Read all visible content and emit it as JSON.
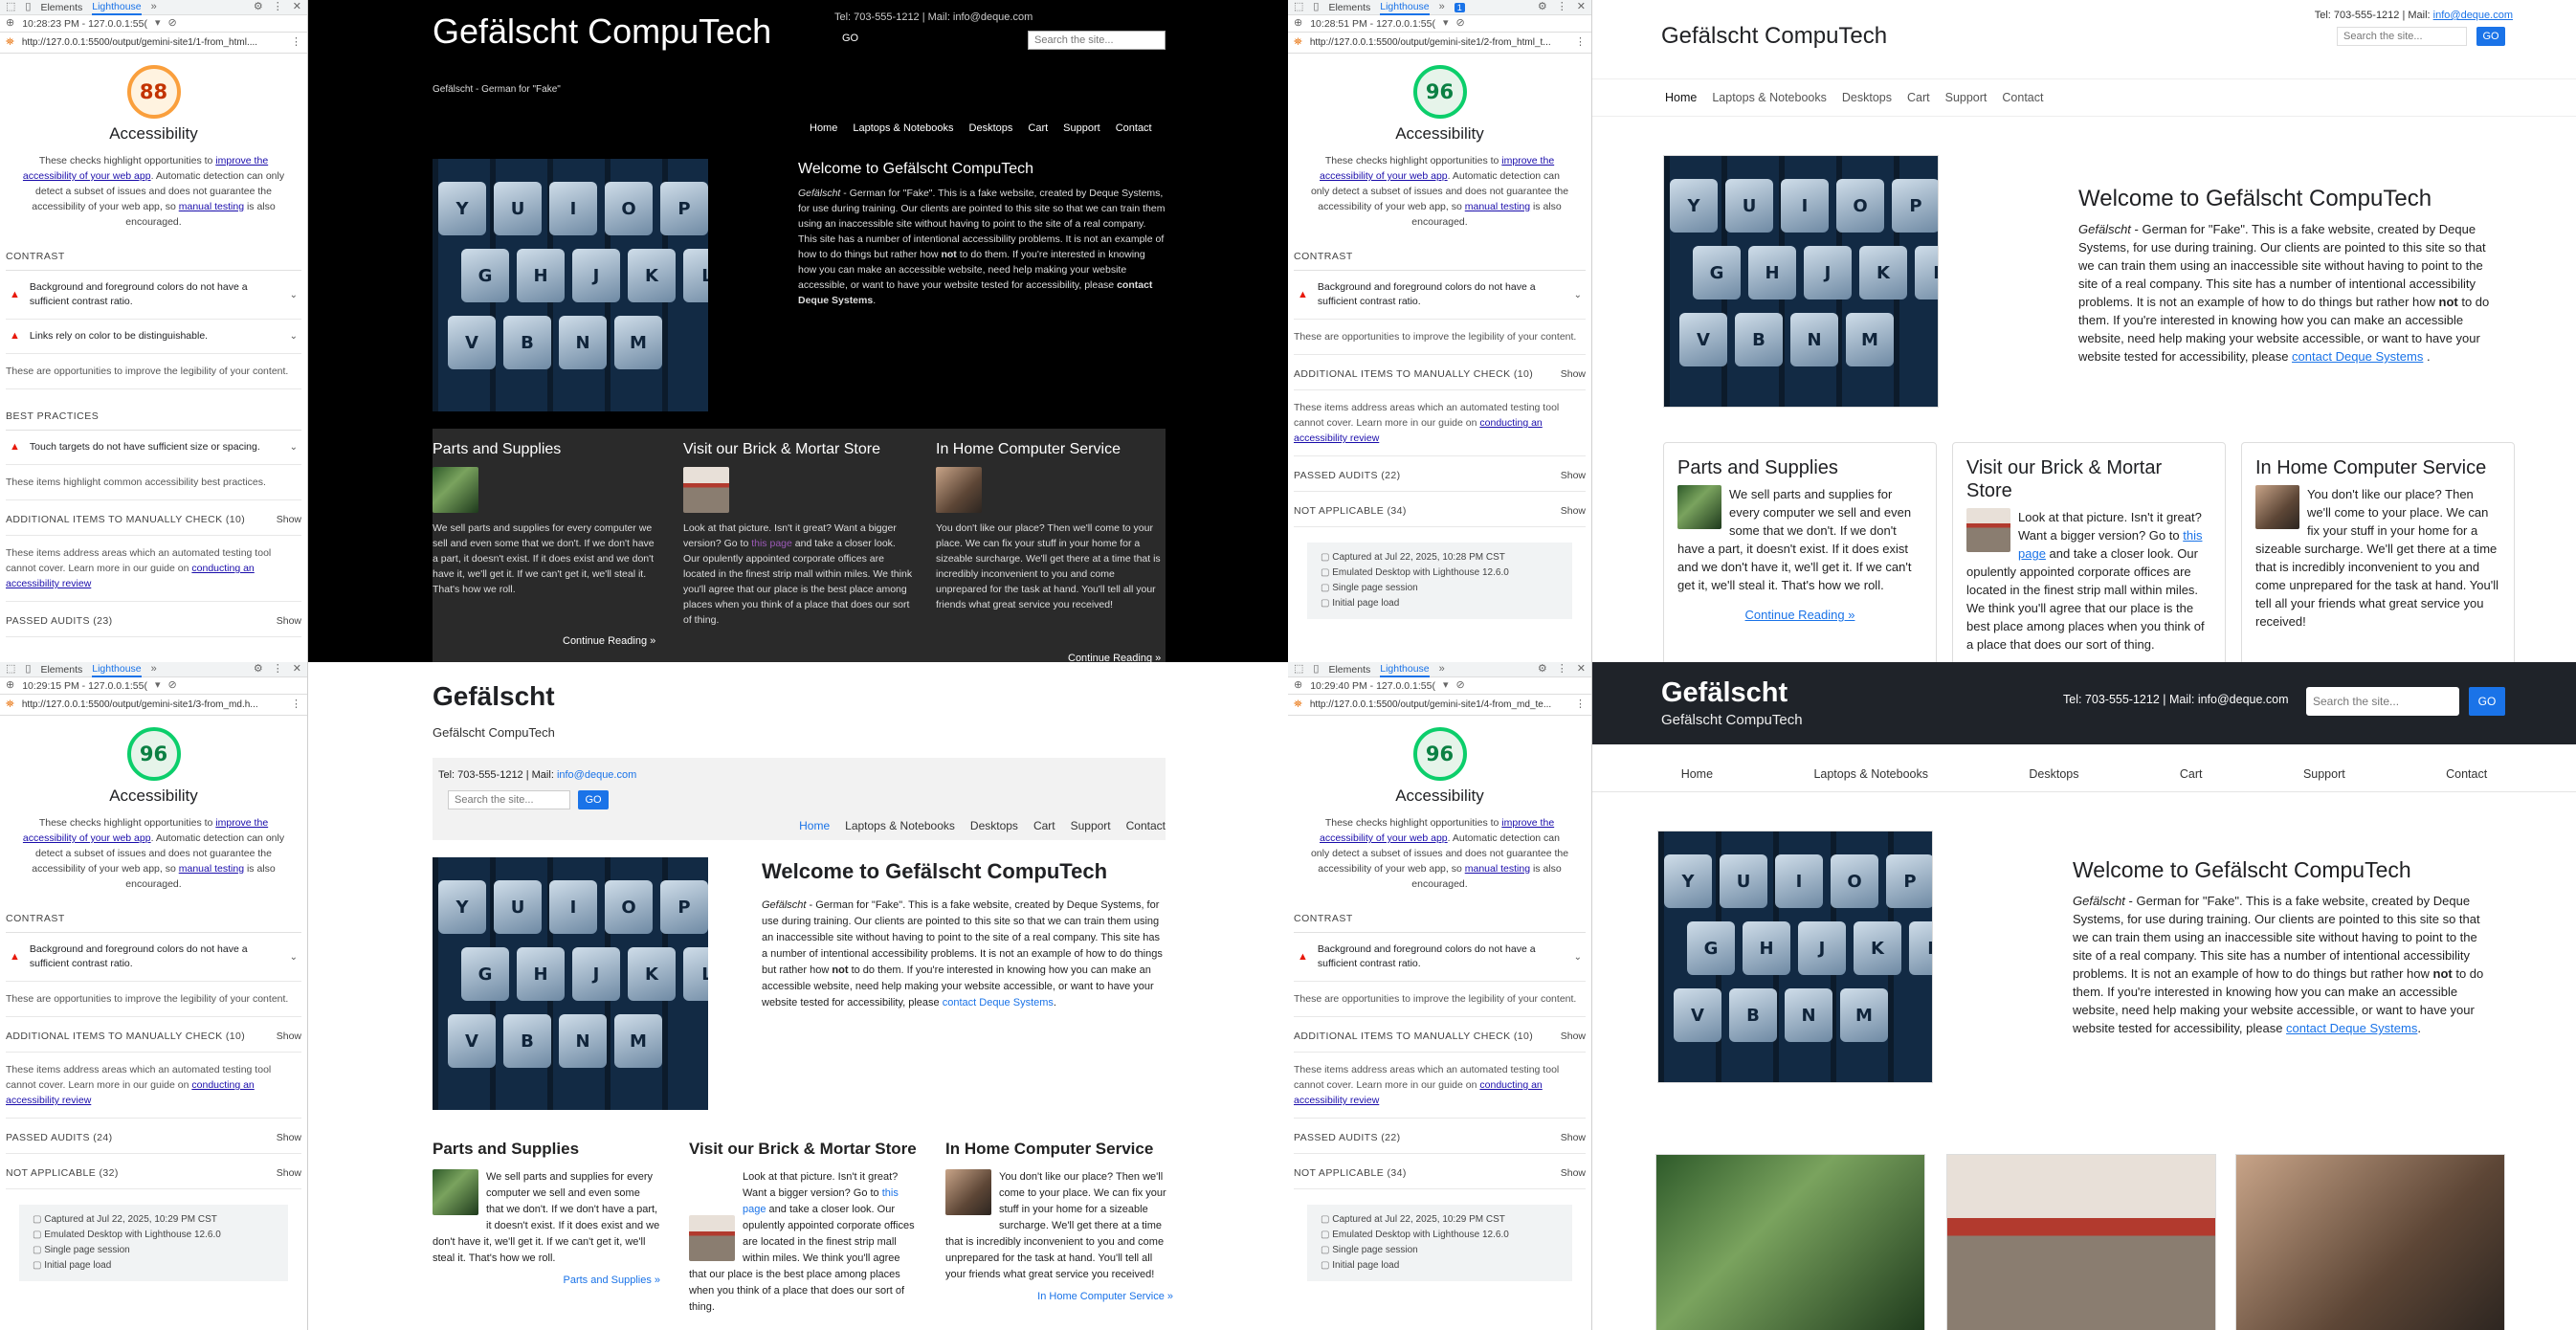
{
  "devtools": {
    "tab_elements": "Elements",
    "tab_lighthouse": "Lighthouse",
    "badge_count": "1",
    "category": "Accessibility",
    "desc_prefix": "These checks highlight opportunities to",
    "desc_link": "improve the accessibility of your web app",
    "desc_mid": ". Automatic detection can only detect a subset of issues and does not guarantee the accessibility of your web app, so",
    "desc_link2": "manual testing",
    "desc_suffix": "is also encouraged.",
    "contrast_heading": "CONTRAST",
    "contrast_audit": "Background and foreground colors do not have a sufficient contrast ratio.",
    "link_audit": "Links rely on color to be distinguishable.",
    "contrast_note": "These are opportunities to improve the legibility of your content.",
    "bp_heading": "BEST PRACTICES",
    "bp_audit": "Touch targets do not have sufficient size or spacing.",
    "bp_note": "These items highlight common accessibility best practices.",
    "manual_heading": "ADDITIONAL ITEMS TO MANUALLY CHECK",
    "manual_count": "(10)",
    "show": "Show",
    "manual_note_prefix": "These items address areas which an automated testing tool cannot cover. Learn more in our guide on",
    "manual_note_link": "conducting an accessibility review",
    "passed_heading": "PASSED AUDITS",
    "na_heading": "NOT APPLICABLE",
    "meta_emulated": "Emulated Desktop with Lighthouse 12.6.0",
    "meta_single": "Single page session",
    "meta_initial": "Initial page load",
    "panels": [
      {
        "time": "10:28:23 PM - 127.0.0.1:55(",
        "url": "http://127.0.0.1:5500/output/gemini-site1/1-from_html....",
        "score": "88",
        "passed": "(23)",
        "na": ""
      },
      {
        "time": "10:28:51 PM - 127.0.0.1:55(",
        "url": "http://127.0.0.1:5500/output/gemini-site1/2-from_html_t...",
        "score": "96",
        "passed": "(22)",
        "na": "(34)",
        "captured": "Captured at Jul 22, 2025, 10:28 PM CST"
      },
      {
        "time": "10:29:15 PM - 127.0.0.1:55(",
        "url": "http://127.0.0.1:5500/output/gemini-site1/3-from_md.h...",
        "score": "96",
        "passed": "(24)",
        "na": "(32)",
        "captured": "Captured at Jul 22, 2025, 10:29 PM CST"
      },
      {
        "time": "10:29:40 PM - 127.0.0.1:55(",
        "url": "http://127.0.0.1:5500/output/gemini-site1/4-from_md_te...",
        "score": "96",
        "passed": "(22)",
        "na": "(34)",
        "captured": "Captured at Jul 22, 2025, 10:29 PM CST"
      }
    ]
  },
  "site": {
    "brand": "Gefälscht CompuTech",
    "brand_short": "Gefälscht",
    "tagline": "Gefälscht - German for \"Fake\"",
    "contact_prefix": "Tel: 703-555-1212 | Mail:",
    "contact_phone": "Tel: 703-555-1212 | Mail: info@deque.com",
    "email": "info@deque.com",
    "search_placeholder": "Search the site...",
    "go": "GO",
    "nav": [
      "Home",
      "Laptops & Notebooks",
      "Desktops",
      "Cart",
      "Support",
      "Contact"
    ],
    "welcome_title": "Welcome to Gefälscht CompuTech",
    "welcome_em": "Gefälscht",
    "welcome_body_a": "- German for \"Fake\". This is a fake website, created by Deque Systems, for use during training. Our clients are pointed to this site so that we can train them using an inaccessible site without having to point to the site of a real company. This site has a number of intentional accessibility problems. It is not an example of how to do things but rather how",
    "welcome_not": "not",
    "welcome_body_b": "to do them. If you're interested in knowing how you can make an accessible website, need help making your website accessible, or want to have your website tested for accessibility, please",
    "welcome_link": "contact Deque Systems",
    "keys": [
      "Y",
      "U",
      "I",
      "O",
      "P",
      "G",
      "H",
      "J",
      "K",
      "L",
      "V",
      "B",
      "N",
      "M"
    ],
    "cards": [
      {
        "title": "Parts and Supplies",
        "body": "We sell parts and supplies for every computer we sell and even some that we don't. If we don't have a part, it doesn't exist. If it does exist and we don't have it, we'll get it. If we can't get it, we'll steal it. That's how we roll.",
        "more": "Continue Reading »",
        "more_alt": "Parts and Supplies »"
      },
      {
        "title": "Visit our Brick & Mortar Store",
        "body_a": "Look at that picture. Isn't it great? Want a bigger version? Go to",
        "link": "this page",
        "body_b": "and take a closer look. Our opulently appointed corporate offices are located in the finest strip mall within miles. We think you'll agree that our place is the best place among places when you think of a place that does our sort of thing."
      },
      {
        "title": "In Home Computer Service",
        "body": "You don't like our place? Then we'll come to your place. We can fix your stuff in your home for a sizeable surcharge. We'll get there at a time that is incredibly inconvenient to you and come unprepared for the task at hand. You'll tell all your friends what great service you received!",
        "more": "Continue Reading »",
        "more_alt": "In Home Computer Service »"
      }
    ]
  }
}
